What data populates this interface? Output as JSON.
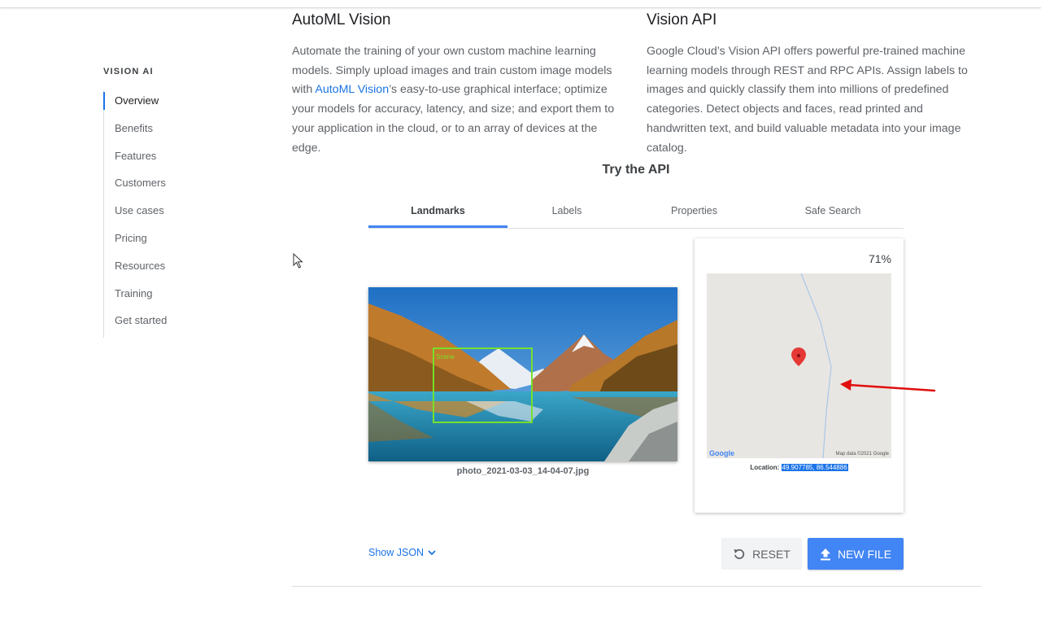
{
  "sidebar": {
    "heading": "VISION AI",
    "items": [
      {
        "label": "Overview"
      },
      {
        "label": "Benefits"
      },
      {
        "label": "Features"
      },
      {
        "label": "Customers"
      },
      {
        "label": "Use cases"
      },
      {
        "label": "Pricing"
      },
      {
        "label": "Resources"
      },
      {
        "label": "Training"
      },
      {
        "label": "Get started"
      }
    ]
  },
  "automl": {
    "title": "AutoML Vision",
    "text_before": "Automate the training of your own custom machine learning models. Simply upload images and train custom image models with ",
    "link": "AutoML Vision",
    "text_after": "’s easy-to-use graphical interface; optimize your models for accuracy, latency, and size; and export them to your application in the cloud, or to an array of devices at the edge."
  },
  "vision_api": {
    "title": "Vision API",
    "text": "Google Cloud’s Vision API offers powerful pre-trained machine learning models through REST and RPC APIs. Assign labels to images and quickly classify them into millions of predefined categories. Detect objects and faces, read printed and handwritten text, and build valuable metadata into your image catalog."
  },
  "try_api": {
    "title": "Try the API",
    "tabs": [
      {
        "label": "Landmarks",
        "active": true
      },
      {
        "label": "Labels"
      },
      {
        "label": "Properties"
      },
      {
        "label": "Safe Search"
      }
    ],
    "image_filename": "photo_2021-03-03_14-04-07.jpg",
    "result": {
      "confidence": "71%",
      "map_logo": "Google",
      "map_attribution": "Map data ©2021 Google",
      "location_label": "Location: ",
      "location_value": "49.907785, 86.544886"
    },
    "show_json": "Show JSON",
    "reset_label": "RESET",
    "new_file_label": "NEW FILE"
  },
  "colors": {
    "accent": "#4285f4",
    "link": "#1a73e8",
    "bounding_box": "#76e02a",
    "map_pin": "#e53935",
    "annotation_arrow": "#e10e0e"
  }
}
